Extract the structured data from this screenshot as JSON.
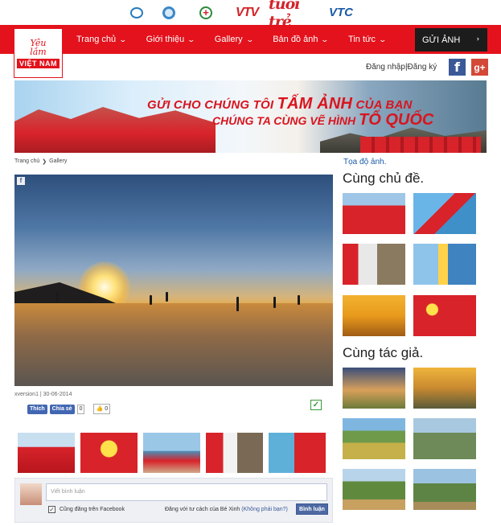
{
  "partners": [
    {
      "name": "govn-logo",
      "label": "govn"
    },
    {
      "name": "gov-emblem-logo",
      "label": ""
    },
    {
      "name": "red-cross-logo",
      "label": "+"
    },
    {
      "name": "vtv-logo",
      "label": "VTV"
    },
    {
      "name": "tuoi-tre-logo",
      "label": "tuổi trẻ"
    },
    {
      "name": "vtc-logo",
      "label": "VTC"
    }
  ],
  "logo": {
    "line1": "Yêu",
    "line2": "lắm",
    "line3": "VIỆT NAM"
  },
  "nav": {
    "items": [
      "Trang chủ",
      "Giới thiệu",
      "Gallery",
      "Bản đồ ảnh",
      "Tin tức"
    ],
    "send_photo": "GỬI ẢNH"
  },
  "auth": {
    "login": "Đăng nhập",
    "separator": "|",
    "register": "Đăng ký"
  },
  "banner": {
    "line1_a": "GỬI CHO CHÚNG TÔI ",
    "line1_b": "TẤM ẢNH",
    "line1_c": " CỦA BẠN",
    "line2_a": "CHÚNG TA CÙNG VẼ HÌNH ",
    "line2_b": "TỔ QUỐC"
  },
  "breadcrumb": {
    "home": "Trang chủ",
    "sep": "❯",
    "current": "Gallery"
  },
  "photo": {
    "meta": "xversion1 | 30-06-2014"
  },
  "share": {
    "like": "Thích",
    "share": "Chia sẻ",
    "share_count": "0",
    "up_count": "0"
  },
  "comments": {
    "placeholder": "Viết bình luận",
    "also_post": "Cũng đăng trên Facebook",
    "posting_as": "Đăng với tư cách của Bé Xinh",
    "not_you": "(Không phải bạn?)",
    "post_button": "Bình luận"
  },
  "sidebar": {
    "coords": "Tọa độ ảnh.",
    "same_topic": "Cùng chủ đề.",
    "same_author": "Cùng tác giả."
  },
  "colors": {
    "brand_red": "#e3121c",
    "dark": "#1c1c1c",
    "facebook": "#3b5998",
    "google_plus": "#d34836"
  }
}
